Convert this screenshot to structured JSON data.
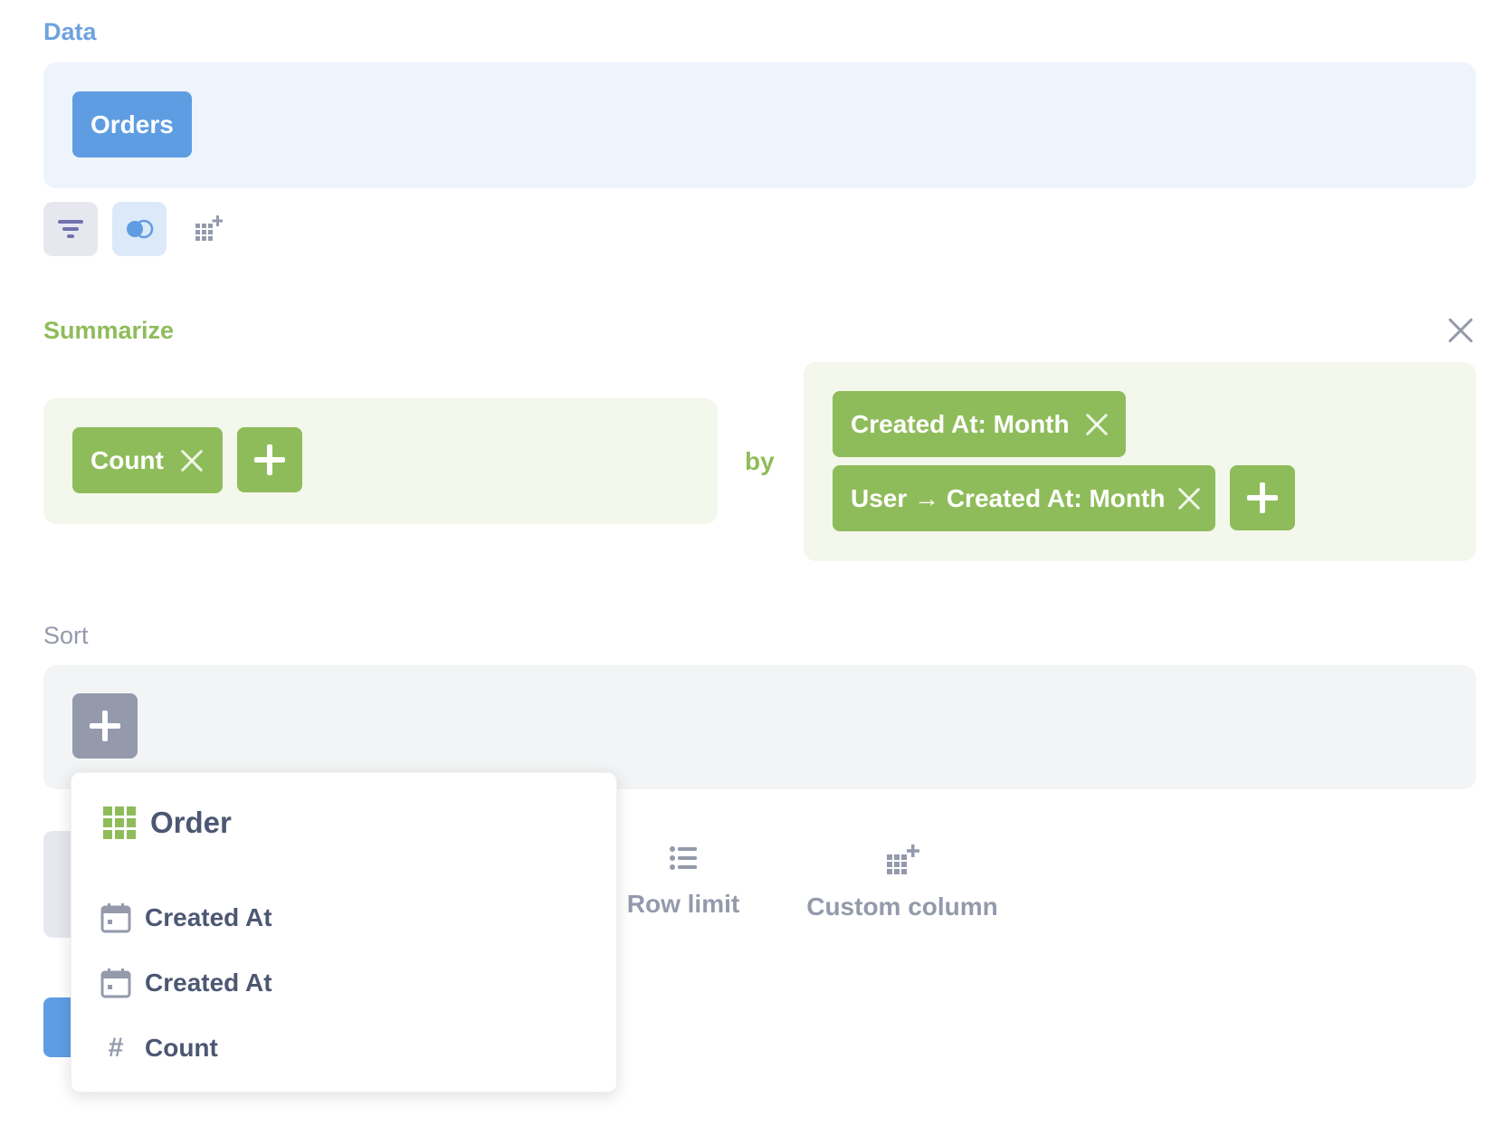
{
  "data_section": {
    "label": "Data",
    "table_pill": "Orders"
  },
  "toolbar": {
    "filter_icon": "filter-icon",
    "join_icon": "join-icon",
    "custom_column_icon": "custom-column-icon"
  },
  "summarize": {
    "label": "Summarize",
    "metrics": [
      {
        "label": "Count"
      }
    ],
    "by_label": "by",
    "groupings": [
      {
        "label": "Created At: Month"
      },
      {
        "label": "User → Created At: Month"
      }
    ]
  },
  "sort": {
    "label": "Sort"
  },
  "actions": {
    "row_limit": "Row limit",
    "custom_column": "Custom column"
  },
  "sort_popover": {
    "title": "Order",
    "items": [
      {
        "label": "Created At",
        "icon": "calendar-icon"
      },
      {
        "label": "Created At",
        "icon": "calendar-icon"
      },
      {
        "label": "Count",
        "icon": "hash-icon",
        "symbol": "#"
      }
    ]
  },
  "colors": {
    "data_accent": "#5e9de2",
    "summarize_accent": "#8fbc5a",
    "sort_accent": "#949aab",
    "text": "#4c5773"
  }
}
